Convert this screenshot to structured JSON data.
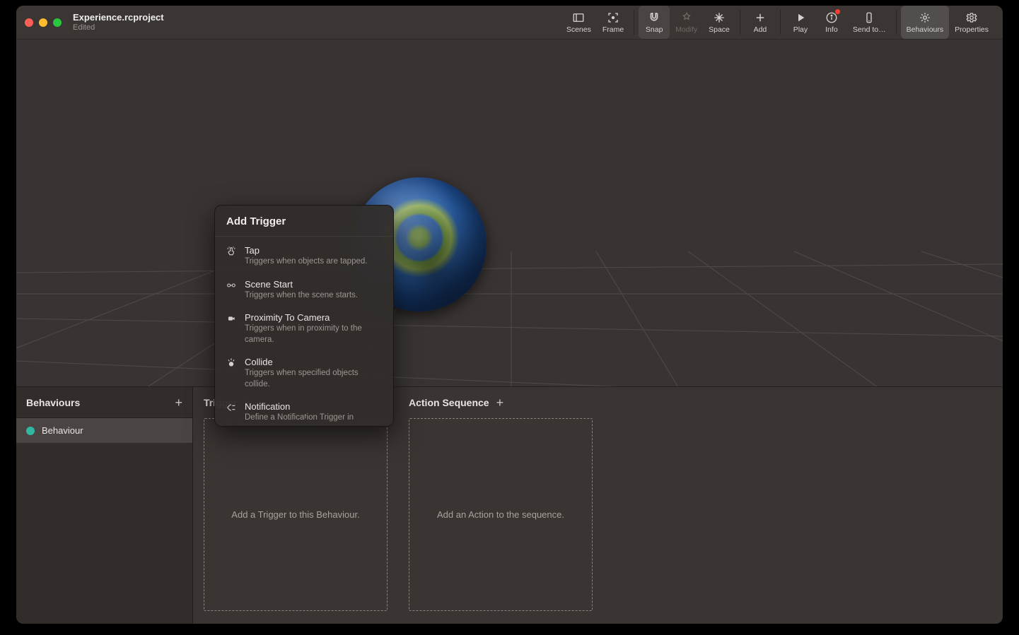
{
  "window": {
    "title": "Experience.rcproject",
    "subtitle": "Edited"
  },
  "toolbar": {
    "scenes": "Scenes",
    "frame": "Frame",
    "snap": "Snap",
    "modify": "Modify",
    "space": "Space",
    "add": "Add",
    "play": "Play",
    "info": "Info",
    "sendto": "Send to…",
    "behaviours": "Behaviours",
    "properties": "Properties"
  },
  "sidebar": {
    "title": "Behaviours",
    "items": [
      {
        "label": "Behaviour"
      }
    ]
  },
  "panels": {
    "trigger": {
      "title": "Trigger",
      "placeholder": "Add a Trigger to this Behaviour."
    },
    "action": {
      "title": "Action Sequence",
      "placeholder": "Add an Action to the sequence."
    }
  },
  "popover": {
    "title": "Add Trigger",
    "items": [
      {
        "title": "Tap",
        "desc": "Triggers when objects are tapped."
      },
      {
        "title": "Scene Start",
        "desc": "Triggers when the scene starts."
      },
      {
        "title": "Proximity To Camera",
        "desc": "Triggers when in proximity to the camera."
      },
      {
        "title": "Collide",
        "desc": "Triggers when specified objects collide."
      },
      {
        "title": "Notification",
        "desc": "Define a Notification Trigger in"
      }
    ]
  }
}
